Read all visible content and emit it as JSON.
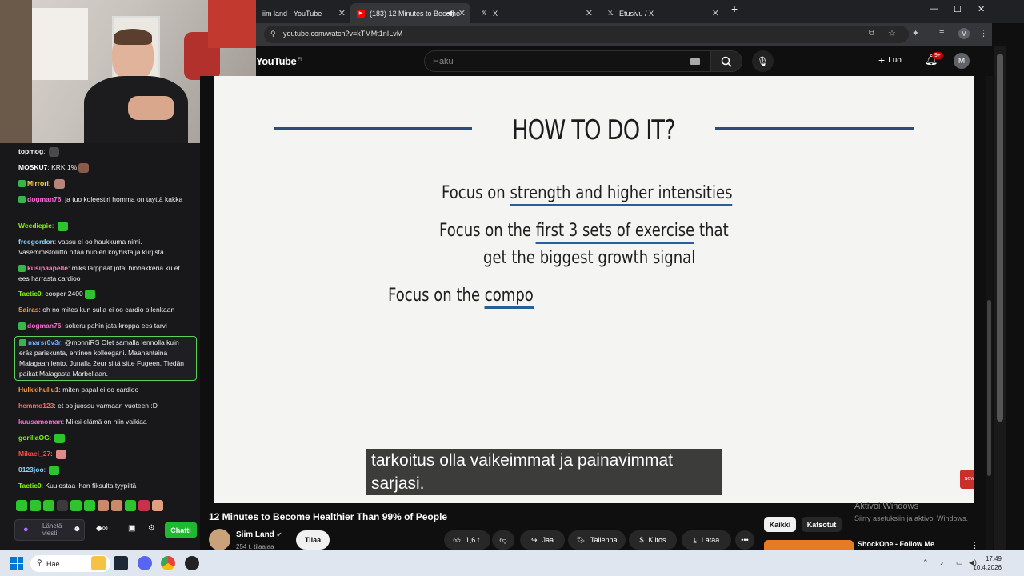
{
  "browser": {
    "tabs": [
      {
        "label": "iim land - YouTube",
        "active": false
      },
      {
        "label": "(183) 12 Minutes to Become",
        "active": true
      },
      {
        "label": "X",
        "active": false
      },
      {
        "label": "Etusivu / X",
        "active": false
      }
    ],
    "new_tab": "+",
    "url": "youtube.com/watch?v=kTMMt1nILvM"
  },
  "youtube": {
    "logo": "YouTube",
    "region": "FI",
    "search_placeholder": "Haku",
    "create_label": "Luo",
    "notifications": "9+",
    "account_initial": "M"
  },
  "slide": {
    "title": "HOW TO DO IT?",
    "line1_prefix": "Focus on ",
    "line1_highlight": "strength and higher intensities",
    "line2_prefix": "Focus on the ",
    "line2_highlight": "first 3 sets of exercise",
    "line2_suffix": " that",
    "line3": "get the biggest growth signal",
    "line4_prefix": "Focus on the ",
    "line4_highlight": "compo"
  },
  "subtitle": {
    "line1": "tarkoitus olla vaikeimmat ja painavimmat",
    "line2": "sarjasi."
  },
  "video_badge": "NOW",
  "video_info": {
    "title": "12 Minutes to Become Healthier Than 99% of People",
    "channel": "Siim Land",
    "subscribers": "254 t. tilaajaa",
    "subscribe_label": "Tilaa",
    "likes": "1,6 t.",
    "share_label": "Jaa",
    "save_label": "Tallenna",
    "thanks_label": "Kiitos",
    "download_label": "Lataa"
  },
  "recommendations": {
    "chips": [
      "Kaikki",
      "Katsotut"
    ],
    "first_title": "ShockOne - Follow Me"
  },
  "windows_activation": {
    "line1": "Aktivoi Windows",
    "line2": "Siirry asetuksiin ja aktivoi Windows."
  },
  "chat": {
    "messages": [
      {
        "user": "topmog",
        "color": "#ffffff",
        "text": "",
        "emote": "#4a4a4a"
      },
      {
        "user": "MOSKU7",
        "color": "#ffffff",
        "text": "KRK 1%",
        "emote": "#8a5a4a"
      },
      {
        "user": "Mirrori",
        "color": "#ffd34d",
        "text": "",
        "emote": "#b8857a",
        "badge": true
      },
      {
        "user": "dogman76",
        "color": "#ff6ad5",
        "text": "ja tuo koleestiri homma on tayttä kakka",
        "badge": true
      },
      {
        "user": "Weediepie",
        "color": "#7cfc00",
        "text": "",
        "emote": "#2ec42e"
      },
      {
        "user": "freegordon",
        "color": "#8bd4ff",
        "text": "vassu ei oo haukkuma nimi. Vasemmistoliitto pitää huolen köyhistä ja kurjista."
      },
      {
        "user": "kusipaapelle",
        "color": "#ff7fbf",
        "text": "miks larppaat jotai biohakkeria ku et ees harrasta cardioo",
        "badge": true
      },
      {
        "user": "Tactic0",
        "color": "#7cfc00",
        "text": "cooper 2400",
        "emote": "#2ec42e"
      },
      {
        "user": "Sairas",
        "color": "#ff9a3c",
        "text": "oh no mites kun sulla ei oo cardio ollenkaan"
      },
      {
        "user": "dogman76",
        "color": "#ff6ad5",
        "text": "sokeru pahin jata kroppa ees tarvi",
        "badge": true
      },
      {
        "user": "marsr0v3r",
        "color": "#6ab0ff",
        "text": "@monniRS Olet samalla lennolla kuin eräs pariskunta, entinen kolleegani. Maanantaina Malagaan lento. Junalla 2eur siitä sitte Fugeen. Tiedän paikat Malagasta Marbellaan.",
        "badge": true
      },
      {
        "user": "Hulkkihullu1",
        "color": "#ff9a3c",
        "text": "miten papal ei oo cardioo"
      },
      {
        "user": "hemmo123",
        "color": "#ff6a6a",
        "text": "et oo juossu varmaan vuoteen :D"
      },
      {
        "user": "kuusamoman",
        "color": "#ff6ad5",
        "text": "Miksi elämä on niin vaikiaa"
      },
      {
        "user": "gorillaOG",
        "color": "#7cfc00",
        "text": "",
        "emote": "#2ec42e"
      },
      {
        "user": "Mikael_27",
        "color": "#ff4a4a",
        "text": "",
        "emote": "#e08a8a"
      },
      {
        "user": "0123joo",
        "color": "#8bd4ff",
        "text": "",
        "emote": "#2ec42e"
      },
      {
        "user": "Tactic0",
        "color": "#7cfc00",
        "text": "Kuulostaa ihan fiksulta tyypiltä"
      }
    ],
    "input_placeholder": "Lähetä viesti",
    "chat_button": "Chatti"
  },
  "taskbar": {
    "search_label": "Hae",
    "time": "17.49",
    "date": "10.4.2026"
  }
}
